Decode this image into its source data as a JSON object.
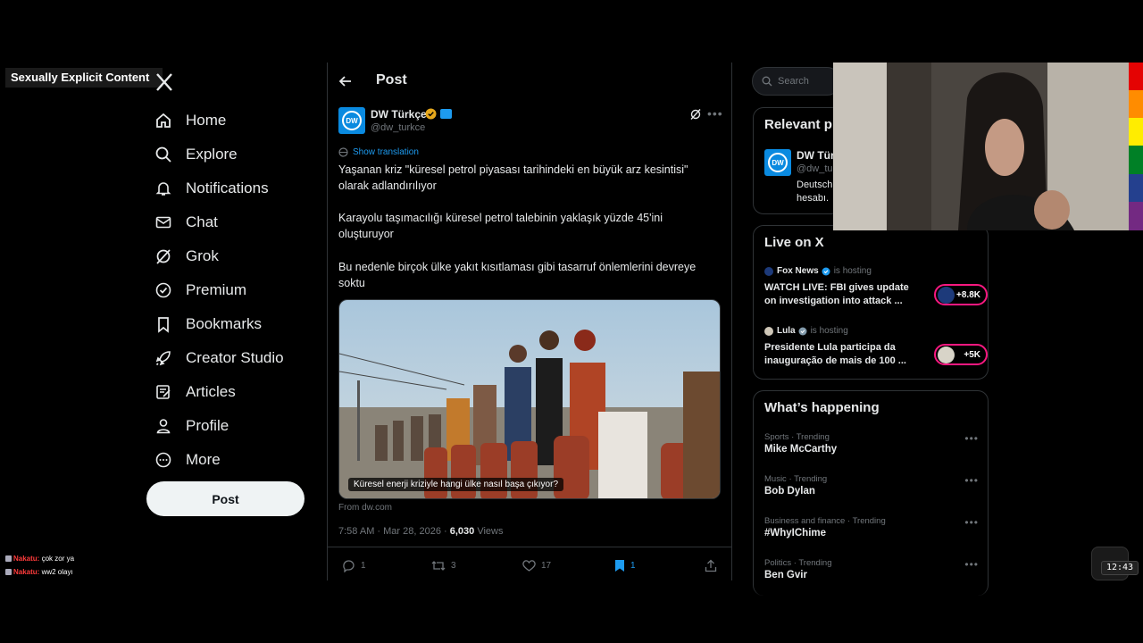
{
  "overlay": {
    "explicit_label": "Sexually Explicit Content"
  },
  "nav": {
    "items": [
      {
        "label": "Home",
        "icon": "home-icon"
      },
      {
        "label": "Explore",
        "icon": "search-icon"
      },
      {
        "label": "Notifications",
        "icon": "bell-icon"
      },
      {
        "label": "Chat",
        "icon": "mail-icon"
      },
      {
        "label": "Grok",
        "icon": "grok-icon"
      },
      {
        "label": "Premium",
        "icon": "verified-badge-icon"
      },
      {
        "label": "Bookmarks",
        "icon": "bookmark-icon"
      },
      {
        "label": "Creator Studio",
        "icon": "rocket-icon"
      },
      {
        "label": "Articles",
        "icon": "article-icon"
      },
      {
        "label": "Profile",
        "icon": "person-icon"
      },
      {
        "label": "More",
        "icon": "more-circle-icon"
      }
    ],
    "post_button": "Post"
  },
  "chat_overlay": [
    {
      "user": "Nakatu:",
      "text": "çok zor ya"
    },
    {
      "user": "Nakatu:",
      "text": "ww2 olayı"
    }
  ],
  "header": {
    "title": "Post"
  },
  "tweet": {
    "author": "DW Türkçe",
    "handle": "@dw_turkce",
    "avatar_text": "DW",
    "show_translation": "Show translation",
    "paragraphs": [
      "Yaşanan kriz \"küresel petrol piyasası tarihindeki en büyük arz kesintisi\" olarak adlandırılıyor",
      "Karayolu taşımacılığı küresel petrol talebinin yaklaşık yüzde 45'ini oluşturuyor",
      "Bu nedenle birçok ülke yakıt kısıtlaması gibi tasarruf önlemlerini devreye soktu"
    ],
    "media_caption": "Küresel enerji kriziyle hangi ülke nasıl başa çıkıyor?",
    "source": "From dw.com",
    "time": "7:58 AM · Mar 28, 2026 · ",
    "views_count": "6,030",
    "views_label": " Views",
    "replies": "1",
    "reposts": "3",
    "likes": "17",
    "bookmarks": "1"
  },
  "sidebar": {
    "search_placeholder": "Search",
    "relevant": {
      "title": "Relevant p",
      "name": "DW Türk",
      "handle": "@dw_tur",
      "bio_line1": "Deutsch",
      "bio_line2": "hesabı."
    },
    "live": {
      "title": "Live on X",
      "items": [
        {
          "host": "Fox News",
          "status": "is hosting",
          "title_line1": "WATCH LIVE: FBI gives update",
          "title_line2": "on investigation into attack ...",
          "count": "+8.8K"
        },
        {
          "host": "Lula",
          "status": "is hosting",
          "title_line1": "Presidente Lula participa da",
          "title_line2": "inauguração de mais de 100 ...",
          "count": "+5K"
        }
      ]
    },
    "happening": {
      "title": "What’s happening",
      "trends": [
        {
          "category": "Sports · Trending",
          "name": "Mike McCarthy"
        },
        {
          "category": "Music · Trending",
          "name": "Bob Dylan"
        },
        {
          "category": "Business and finance · Trending",
          "name": "#WhyIChime"
        },
        {
          "category": "Politics · Trending",
          "name": "Ben Gvir"
        }
      ]
    }
  },
  "clock": "12:43",
  "colors": {
    "accent": "#1d9bf0",
    "live": "#f91880",
    "gold": "#e7a81c"
  }
}
